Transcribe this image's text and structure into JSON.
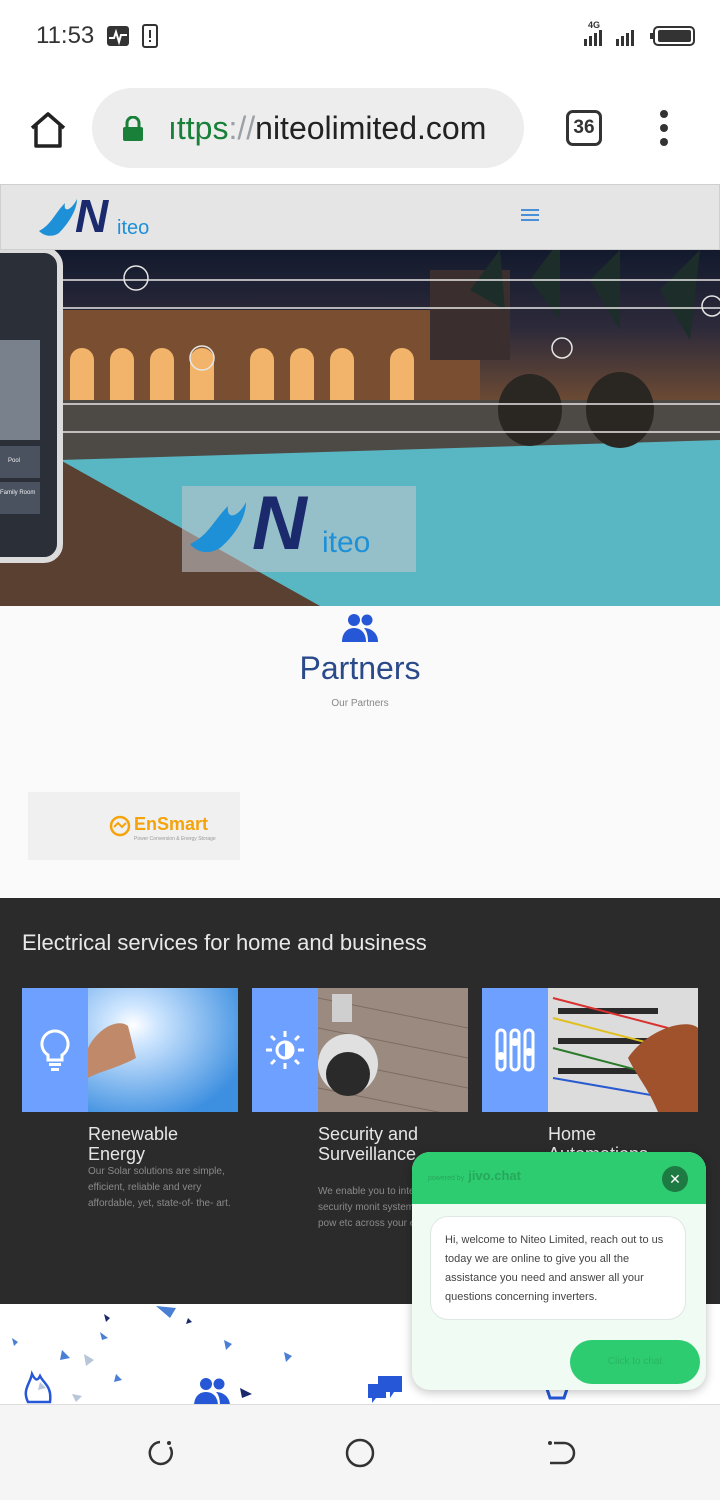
{
  "status_bar": {
    "time": "11:53",
    "network": "4G"
  },
  "browser": {
    "url_scheme": "https",
    "url_sep": "://",
    "url_host": "niteolimited.com",
    "url_visible_prefix": "ıttps",
    "tab_count": "36"
  },
  "site": {
    "logo_letter": "N",
    "logo_text": "iteo"
  },
  "hero": {
    "logo_letter": "N",
    "logo_text": "iteo",
    "tablet_labels": [
      "Pool",
      "Family Room"
    ]
  },
  "partners": {
    "title": "Partners",
    "subtitle": "Our Partners",
    "logos": [
      {
        "name": "EnSmart",
        "tagline": "Power Conversion & Energy Storage"
      }
    ]
  },
  "services": {
    "heading": "Electrical services for home and business",
    "cards": [
      {
        "title": "Renewable Energy",
        "desc": "Our Solar solutions are simple, efficient, reliable and very affordable, yet, state-of- the- art.",
        "icon": "lightbulb-icon"
      },
      {
        "title": "Security and Surveillance",
        "desc": "We enable you to integ control, security monit systems, lightings, pow etc across your enterp",
        "icon": "sun-icon"
      },
      {
        "title": "Home Automations",
        "desc": "",
        "icon": "sliders-icon"
      }
    ]
  },
  "chat": {
    "powered_by": "powered by",
    "brand": "jivo.chat",
    "message": "Hi, welcome to Niteo Limited, reach out to us today we are online to give you all the assistance you need and answer all your questions concerning inverters.",
    "button": "Click to chat",
    "close": "✕"
  },
  "colors": {
    "accent": "#2b4a8a",
    "chat_green": "#2ecc71",
    "service_blue": "#6ea0ff",
    "logo_blue": "#1e90d8"
  }
}
